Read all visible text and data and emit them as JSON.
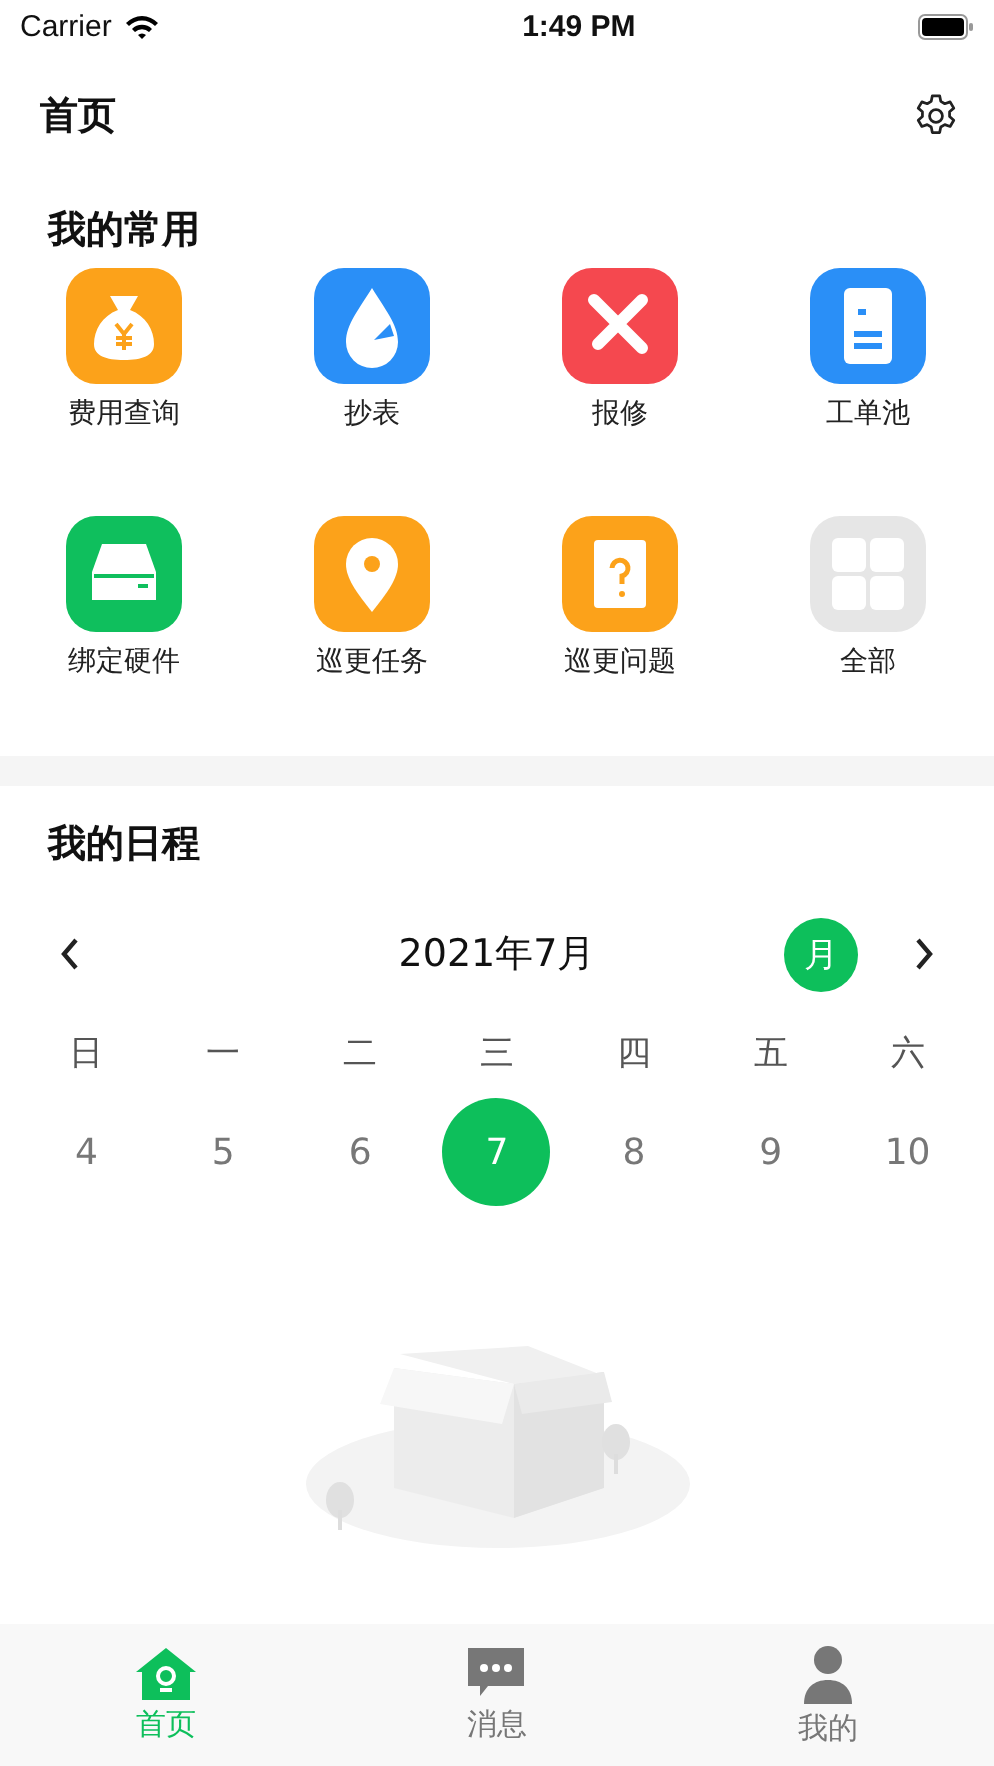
{
  "status_bar": {
    "carrier": "Carrier",
    "time": "1:49 PM"
  },
  "header": {
    "title": "首页"
  },
  "favorites": {
    "title": "我的常用",
    "items": [
      {
        "label": "费用查询",
        "kind": "money"
      },
      {
        "label": "抄表",
        "kind": "meter"
      },
      {
        "label": "报修",
        "kind": "repair"
      },
      {
        "label": "工单池",
        "kind": "order"
      },
      {
        "label": "绑定硬件",
        "kind": "hardware"
      },
      {
        "label": "巡更任务",
        "kind": "patrol"
      },
      {
        "label": "巡更问题",
        "kind": "question"
      },
      {
        "label": "全部",
        "kind": "all"
      }
    ]
  },
  "schedule": {
    "title": "我的日程",
    "month_label": "2021年7月",
    "view_button": {
      "label": "月",
      "selected": true
    },
    "weekdays": [
      "日",
      "一",
      "二",
      "三",
      "四",
      "五",
      "六"
    ],
    "dates": [
      {
        "label": "4",
        "selected": false
      },
      {
        "label": "5",
        "selected": false
      },
      {
        "label": "6",
        "selected": false
      },
      {
        "label": "7",
        "selected": true
      },
      {
        "label": "8",
        "selected": false
      },
      {
        "label": "9",
        "selected": false
      },
      {
        "label": "10",
        "selected": false
      }
    ]
  },
  "tab_bar": {
    "items": [
      {
        "label": "首页",
        "kind": "home",
        "selected": true
      },
      {
        "label": "消息",
        "kind": "message",
        "selected": false
      },
      {
        "label": "我的",
        "kind": "profile",
        "selected": false
      }
    ]
  }
}
